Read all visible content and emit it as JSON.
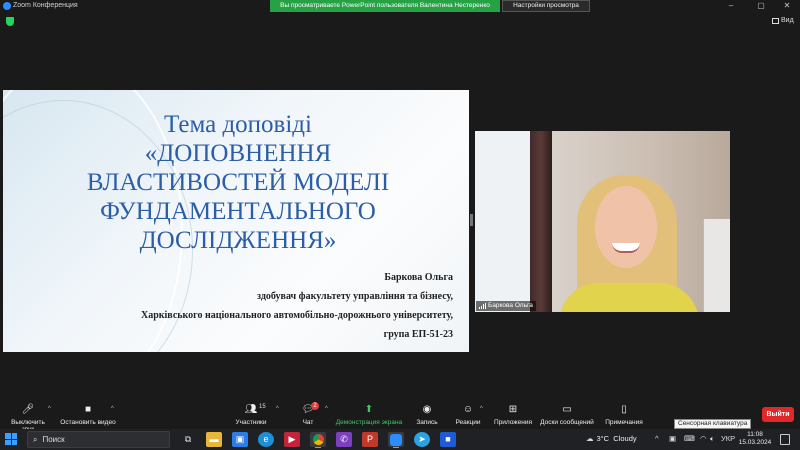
{
  "titlebar": {
    "app_title": "Zoom Конференция",
    "share_banner": "Вы просматриваете PowerPoint пользователя Валентина Нестеренко",
    "view_options": "Настройки просмотра",
    "minimize": "–",
    "maximize": "▢",
    "close": "✕"
  },
  "top_right": {
    "view_label": "Вид"
  },
  "slide": {
    "title_lines": [
      "Тема доповіді",
      "«ДОПОВНЕННЯ",
      "ВЛАСТИВОСТЕЙ МОДЕЛІ",
      "ФУНДАМЕНТАЛЬНОГО",
      "ДОСЛІДЖЕННЯ»"
    ],
    "author_lines": [
      "Баркова Ольга",
      "здобувач факультету управління та бізнесу,",
      "Харківського національного автомобільно-дорожнього університету,",
      "група ЕП-51-23"
    ]
  },
  "video": {
    "participant_name": "Баркова Ольга"
  },
  "toolbar": {
    "mute": "Выключить звук",
    "stop_video": "Остановить видео",
    "participants": "Участники",
    "participants_count": "15",
    "chat": "Чат",
    "chat_badge": "2",
    "share_screen": "Демонстрация экрана",
    "record": "Запись",
    "reactions": "Реакции",
    "apps": "Приложения",
    "whiteboards": "Доски сообщений",
    "notes": "Примечания",
    "tooltip": "Сенсорная клавиатура",
    "leave": "Выйти"
  },
  "taskbar": {
    "search_placeholder": "Поиск",
    "weather_temp": "3°C",
    "weather_desc": "Cloudy",
    "language": "УКР",
    "time": "11:08",
    "date": "15.03.2024"
  },
  "colors": {
    "accent_green": "#26a244",
    "leave_red": "#e02828",
    "slide_title": "#2b5ea7"
  }
}
